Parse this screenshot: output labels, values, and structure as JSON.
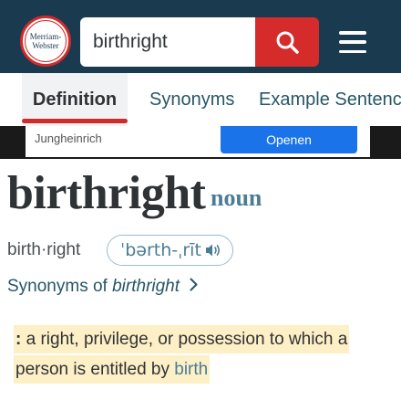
{
  "header": {
    "logo_line1": "Merriam-",
    "logo_line2": "Webster",
    "search_value": "birthright",
    "icons": {
      "search": "search-icon",
      "menu": "hamburger-menu-icon"
    },
    "colors": {
      "header_bg": "#193a4f",
      "search_button": "#d52b2b",
      "logo_ring": "#d02b2b"
    }
  },
  "tabs": [
    {
      "label": "Definition",
      "active": true
    },
    {
      "label": "Synonyms"
    },
    {
      "label": "Example Sentenc"
    }
  ],
  "ad": {
    "advertiser": "Jungheinrich",
    "button_label": "Openen"
  },
  "entry": {
    "headword": "birthright",
    "part_of_speech": "noun",
    "syllables": "birth·right",
    "pronunciation": "ˈbərth-ˌrīt",
    "pronunciation_icon": "speaker-icon",
    "synonyms_prefix": "Synonyms of ",
    "synonyms_word": "birthright",
    "synonyms_icon": "chevron-right-icon"
  },
  "definition": {
    "colon": ":",
    "line1": " a right, privilege, or possession to which a",
    "line2_text": "person is entitled by ",
    "line2_link": "birth"
  },
  "colors": {
    "accent_blue": "#4a7d95",
    "highlight": "#fdefc6",
    "tab_underline": "#d02b2b"
  }
}
